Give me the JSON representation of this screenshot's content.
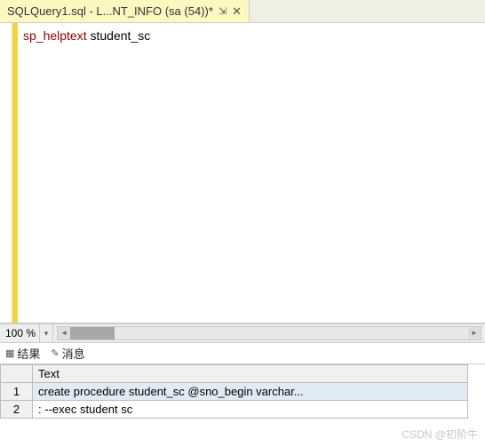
{
  "tab": {
    "title": "SQLQuery1.sql - L...NT_INFO (sa (54))*",
    "pin_icon": "⇲",
    "close_icon": "✕"
  },
  "editor": {
    "keyword": "sp_helptext",
    "argument": " student_sc"
  },
  "zoom": {
    "level": "100 %",
    "arrow": "▾"
  },
  "result_tabs": {
    "results_icon": "▦",
    "results_label": "结果",
    "messages_icon": "✎",
    "messages_label": "消息"
  },
  "grid": {
    "column": "Text",
    "rows": [
      {
        "num": "1",
        "text": "create procedure student_sc  @sno_begin varchar..."
      },
      {
        "num": "2",
        "text": ": --exec student sc"
      }
    ]
  },
  "watermark": "CSDN @初阶牛"
}
